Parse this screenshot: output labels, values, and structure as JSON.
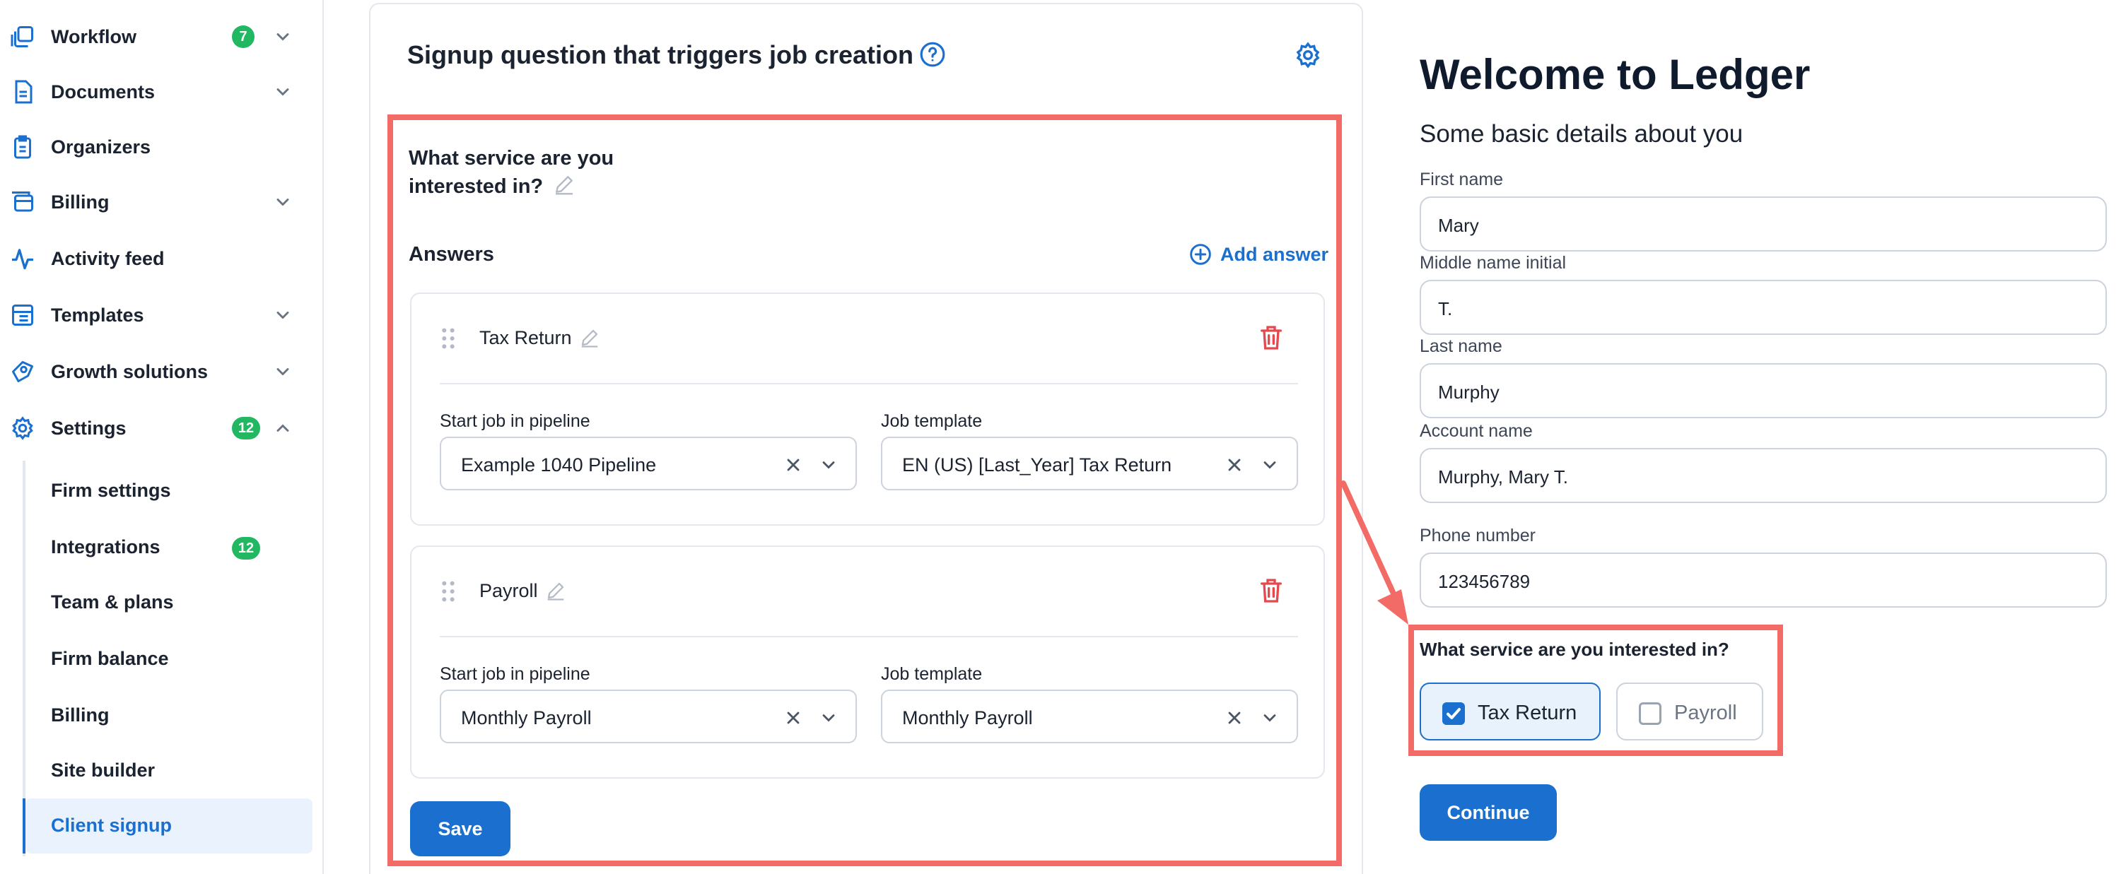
{
  "sidebar": {
    "items": [
      {
        "label": "Workflow",
        "icon": "workflow-icon",
        "badge": "7",
        "chevron": "down"
      },
      {
        "label": "Documents",
        "icon": "documents-icon",
        "chevron": "down"
      },
      {
        "label": "Organizers",
        "icon": "organizers-icon"
      },
      {
        "label": "Billing",
        "icon": "billing-icon",
        "chevron": "down"
      },
      {
        "label": "Activity feed",
        "icon": "activity-icon"
      },
      {
        "label": "Templates",
        "icon": "templates-icon",
        "chevron": "down"
      },
      {
        "label": "Growth solutions",
        "icon": "growth-icon",
        "chevron": "down"
      },
      {
        "label": "Settings",
        "icon": "settings-gear-icon",
        "badge": "12",
        "chevron": "up"
      }
    ],
    "settings_sub": [
      {
        "label": "Firm settings"
      },
      {
        "label": "Integrations",
        "badge": "12"
      },
      {
        "label": "Team & plans"
      },
      {
        "label": "Firm balance"
      },
      {
        "label": "Billing"
      },
      {
        "label": "Site builder"
      },
      {
        "label": "Client signup",
        "active": true
      }
    ]
  },
  "card": {
    "title": "Signup question that triggers job creation",
    "question": "What service are you interested in?",
    "answers_heading": "Answers",
    "add_answer_label": "Add answer",
    "pipeline_label": "Start job in pipeline",
    "template_label": "Job template",
    "answers": [
      {
        "name": "Tax Return",
        "pipeline": "Example 1040 Pipeline",
        "template": "EN (US) [Last_Year] Tax Return"
      },
      {
        "name": "Payroll",
        "pipeline": "Monthly Payroll",
        "template": "Monthly Payroll"
      }
    ],
    "save_label": "Save"
  },
  "signup_form": {
    "title": "Welcome to Ledger",
    "subtitle": "Some basic details about you",
    "fields": [
      {
        "label": "First name",
        "value": "Mary"
      },
      {
        "label": "Middle name initial",
        "value": "T."
      },
      {
        "label": "Last name",
        "value": "Murphy"
      },
      {
        "label": "Account name",
        "value": "Murphy, Mary T."
      },
      {
        "label": "Phone number",
        "value": "123456789"
      }
    ],
    "service_question": "What service are you interested in?",
    "options": [
      {
        "label": "Tax Return",
        "checked": true
      },
      {
        "label": "Payroll",
        "checked": false
      }
    ],
    "continue_label": "Continue"
  },
  "colors": {
    "accent": "#1a6fcf",
    "badge": "#21b861",
    "highlight": "#f36b66",
    "danger": "#e5484d"
  }
}
